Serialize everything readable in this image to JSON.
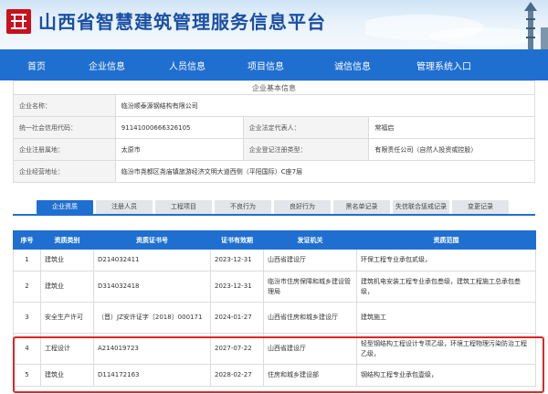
{
  "header": {
    "title": "山西省智慧建筑管理服务信息平台",
    "logo_icon": "logo-emblem-icon",
    "brand_color": "#1f6fd1",
    "logo_color": "#c8101e"
  },
  "nav": {
    "items": [
      {
        "label": "首页"
      },
      {
        "label": "企业信息"
      },
      {
        "label": "人员信息"
      },
      {
        "label": "项目信息"
      },
      {
        "label": "诚信信息"
      },
      {
        "label": "管理系统入口"
      }
    ]
  },
  "basic_info": {
    "section_title": "企业基本信息",
    "company_name_label": "企业名称：",
    "company_name": "临汾顺泰源钢结构有限公司",
    "credit_code_label": "统一社会信用代码：",
    "credit_code": "91141000666326105",
    "legal_rep_label": "企业法定代表人：",
    "legal_rep": "常福启",
    "region_label": "企业注册属地：",
    "region": "太原市",
    "reg_type_label": "企业登记注册类型：",
    "reg_type": "有限责任公司（自然人投资或控股）",
    "address_label": "企业经营地址：",
    "address": "临汾市尧都区尧庙镇旅游经济文明大道西侧（平阳国际）C座7层"
  },
  "tabs": [
    {
      "label": "企业资质",
      "active": true
    },
    {
      "label": "注册人员",
      "active": false
    },
    {
      "label": "工程项目",
      "active": false
    },
    {
      "label": "不良行为",
      "active": false
    },
    {
      "label": "良好行为",
      "active": false
    },
    {
      "label": "黑名单记录",
      "active": false
    },
    {
      "label": "失信联合惩戒记录",
      "active": false
    },
    {
      "label": "变更记录",
      "active": false
    }
  ],
  "qualification_table": {
    "headers": [
      "序号",
      "资质类别",
      "资质证书号",
      "证书有效期",
      "发证机关",
      "资质范围"
    ],
    "rows": [
      {
        "no": "1",
        "category": "建筑业",
        "cert_no": "D214032411",
        "valid": "2023-12-31",
        "authority": "山西省建设厅",
        "scope": "环保工程专业承包贰级，"
      },
      {
        "no": "2",
        "category": "建筑业",
        "cert_no": "D314032418",
        "valid": "2023-12-31",
        "authority": "临汾市住房保障和城乡建设管理局",
        "scope": "建筑机电安装工程专业承包叁级，建筑工程施工总承包叁级，"
      },
      {
        "no": "3",
        "category": "安全生产许可",
        "cert_no": "（晋）JZ安许证字〔2018〕000171",
        "valid": "2024-01-27",
        "authority": "山西省住房和城乡建设厅",
        "scope": "建筑施工"
      },
      {
        "no": "4",
        "category": "工程设计",
        "cert_no": "A214019723",
        "valid": "2027-07-22",
        "authority": "山西省建设厅",
        "scope": "轻型钢结构工程设计专项乙级，环境工程物理污染防治工程乙级，"
      },
      {
        "no": "5",
        "category": "建筑业",
        "cert_no": "D114172163",
        "valid": "2028-02-27",
        "authority": "住房和城乡建设部",
        "scope": "钢结构工程专业承包壹级，"
      }
    ]
  },
  "highlight_color": "#e02424"
}
